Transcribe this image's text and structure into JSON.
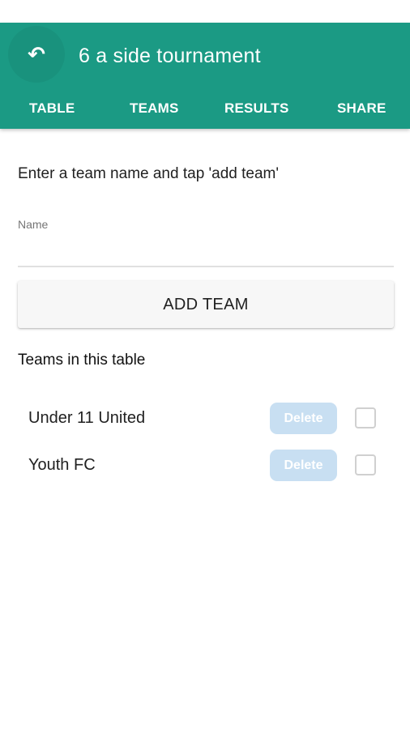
{
  "app_bar": {
    "title": "6 a side tournament",
    "back_icon": "↶",
    "tabs": [
      "TABLE",
      "TEAMS",
      "RESULTS",
      "SHARE"
    ]
  },
  "form": {
    "instruction": "Enter a team name and tap 'add team'",
    "name_label": "Name",
    "name_value": "",
    "add_button_label": "ADD TEAM"
  },
  "teams_section": {
    "heading": "Teams in this table",
    "teams": [
      {
        "name": "Under 11 United",
        "delete_label": "Delete",
        "checked": false
      },
      {
        "name": "Youth FC",
        "delete_label": "Delete",
        "checked": false
      }
    ]
  },
  "colors": {
    "app_bar": "#1b9a84",
    "delete_button": "#c8dff2"
  }
}
